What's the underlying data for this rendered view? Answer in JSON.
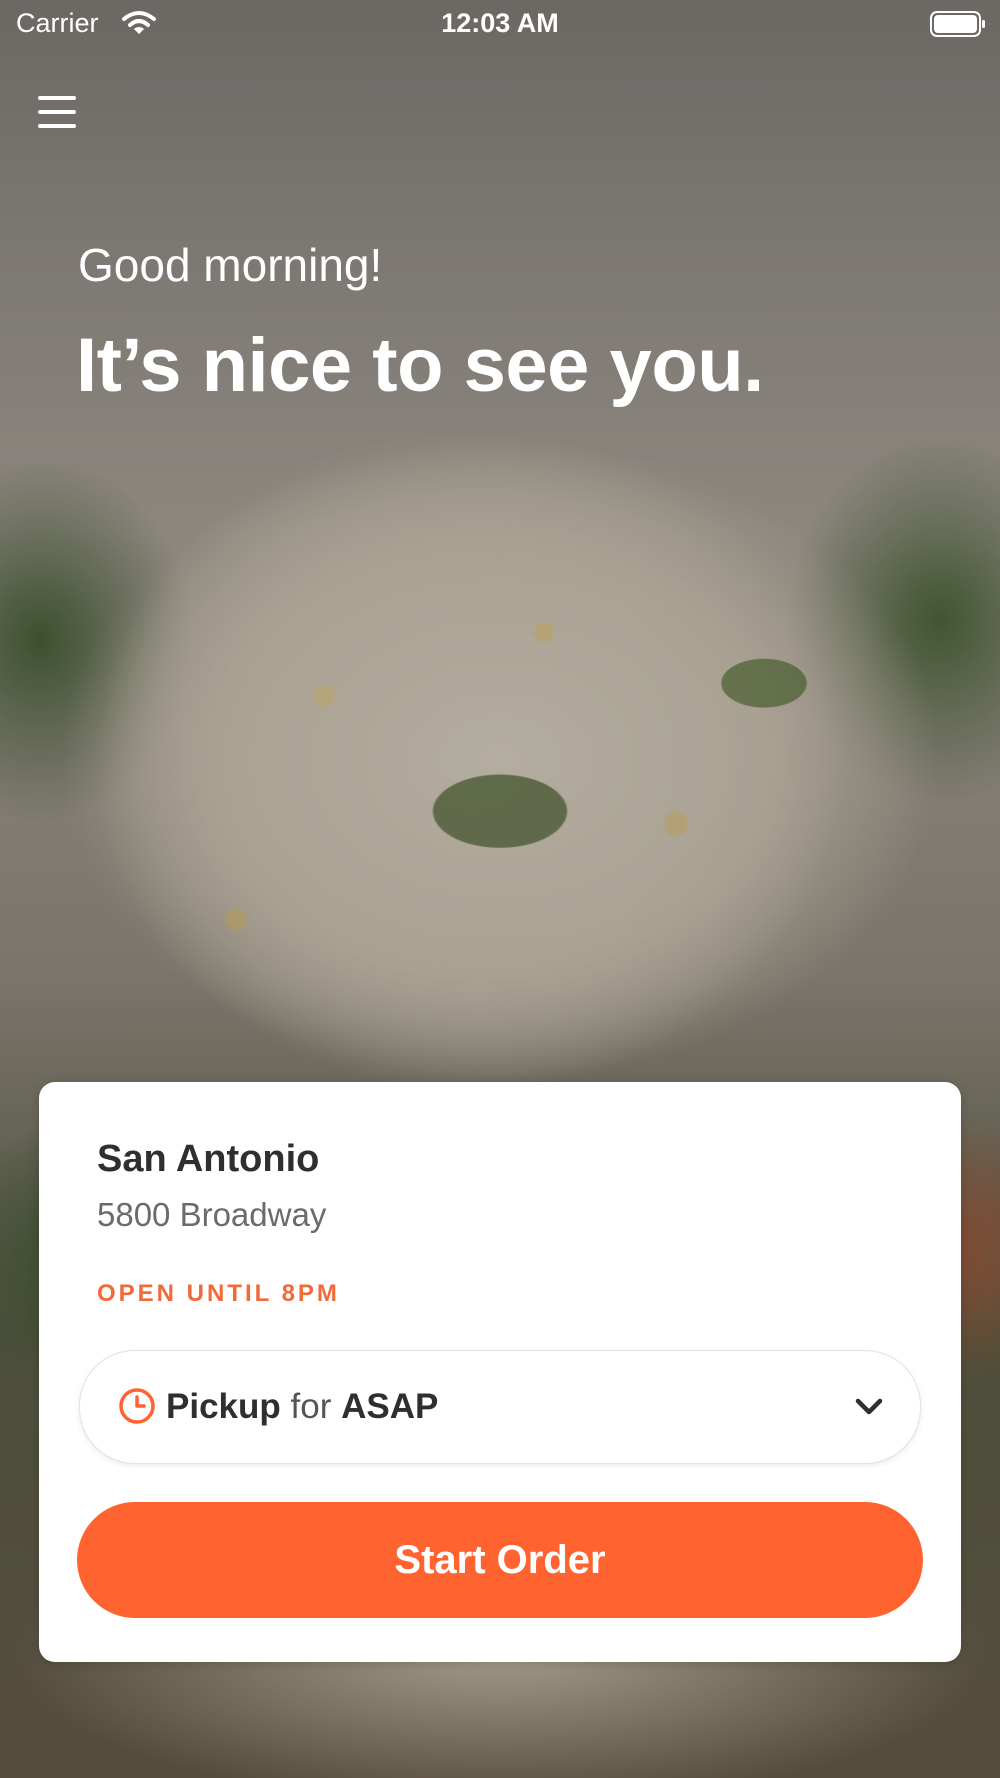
{
  "status_bar": {
    "carrier": "Carrier",
    "time": "12:03 AM",
    "wifi_icon": "wifi-icon",
    "battery_icon": "battery-icon"
  },
  "header": {
    "menu_icon": "hamburger-menu-icon",
    "greeting": "Good morning!",
    "headline": "It’s nice to see you."
  },
  "location_card": {
    "name": "San Antonio",
    "address": "5800 Broadway",
    "hours": "OPEN UNTIL 8PM",
    "order_selector": {
      "mode": "Pickup",
      "connector": "for",
      "time": "ASAP",
      "clock_icon": "clock-icon",
      "chevron_icon": "chevron-down-icon"
    },
    "start_button": "Start Order"
  },
  "colors": {
    "accent": "#ff6430",
    "hours_text": "#f26a3a"
  }
}
